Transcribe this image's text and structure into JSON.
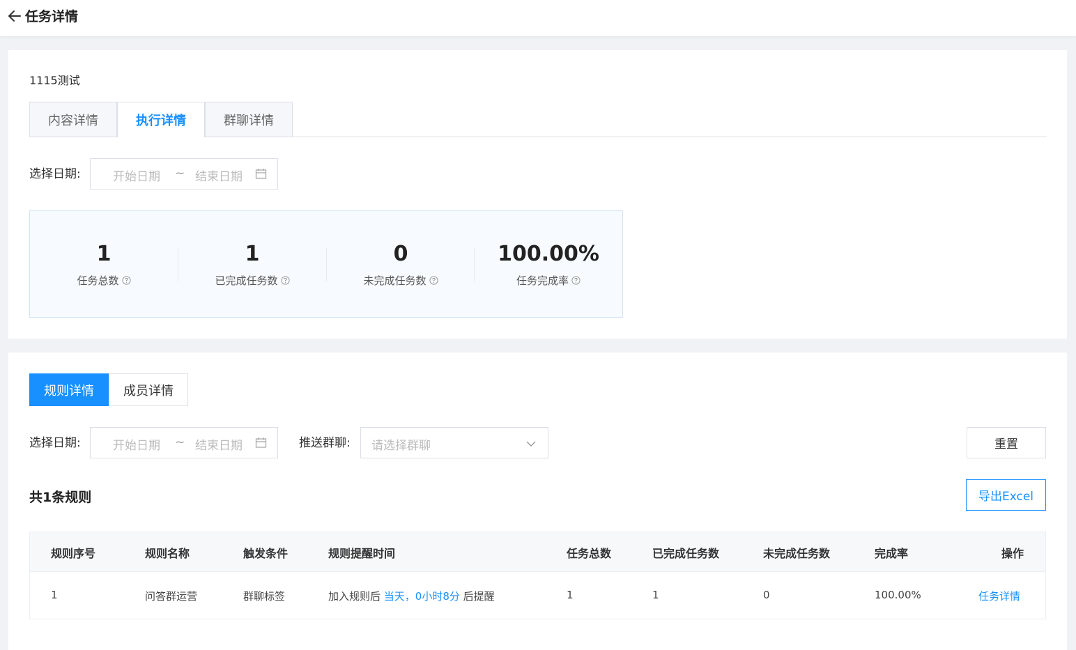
{
  "header": {
    "title": "任务详情"
  },
  "task": {
    "name": "1115测试"
  },
  "tabs": [
    {
      "label": "内容详情"
    },
    {
      "label": "执行详情"
    },
    {
      "label": "群聊详情"
    }
  ],
  "filter1": {
    "label": "选择日期:",
    "start_placeholder": "开始日期",
    "separator": "~",
    "end_placeholder": "结束日期"
  },
  "stats": [
    {
      "value": "1",
      "label": "任务总数"
    },
    {
      "value": "1",
      "label": "已完成任务数"
    },
    {
      "value": "0",
      "label": "未完成任务数"
    },
    {
      "value": "100.00%",
      "label": "任务完成率"
    }
  ],
  "subtabs": [
    {
      "label": "规则详情"
    },
    {
      "label": "成员详情"
    }
  ],
  "filter2": {
    "date_label": "选择日期:",
    "start_placeholder": "开始日期",
    "separator": "~",
    "end_placeholder": "结束日期",
    "group_label": "推送群聊:",
    "group_placeholder": "请选择群聊",
    "reset_label": "重置"
  },
  "rules": {
    "count_text": "共1条规则",
    "export_label": "导出Excel"
  },
  "table": {
    "headers": [
      "规则序号",
      "规则名称",
      "触发条件",
      "规则提醒时间",
      "任务总数",
      "已完成任务数",
      "未完成任务数",
      "完成率",
      "操作"
    ],
    "rows": [
      {
        "index": "1",
        "name": "问答群运营",
        "trigger": "群聊标签",
        "time_prefix": "加入规则后",
        "time_highlight": "当天，0小时8分",
        "time_suffix": "后提醒",
        "total": "1",
        "done": "1",
        "undone": "0",
        "rate": "100.00%",
        "action": "任务详情"
      }
    ]
  },
  "colors": {
    "accent": "#1890ff"
  }
}
